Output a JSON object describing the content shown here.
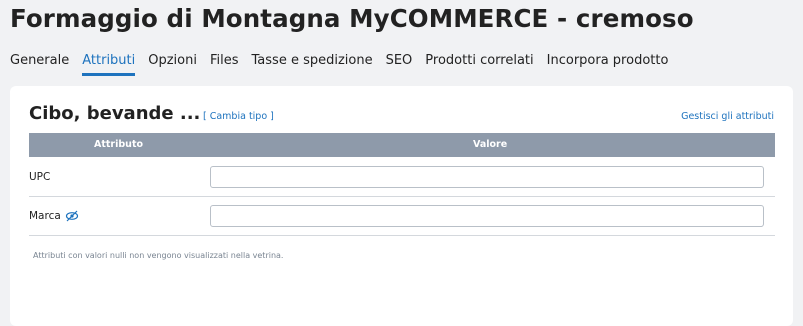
{
  "page": {
    "title": "Formaggio di Montagna MyCOMMERCE - cremoso"
  },
  "tabs": [
    {
      "label": "Generale"
    },
    {
      "label": "Attributi"
    },
    {
      "label": "Opzioni"
    },
    {
      "label": "Files"
    },
    {
      "label": "Tasse e spedizione"
    },
    {
      "label": "SEO"
    },
    {
      "label": "Prodotti correlati"
    },
    {
      "label": "Incorpora prodotto"
    }
  ],
  "active_tab": "Attributi",
  "card": {
    "title": "Cibo, bevande ...",
    "change_type_label": "[ Cambia tipo ]",
    "manage_label": "Gestisci gli attributi",
    "table": {
      "headers": {
        "attribute": "Attributo",
        "value": "Valore"
      },
      "rows": [
        {
          "label": "UPC",
          "value": "",
          "icon": null
        },
        {
          "label": "Marca",
          "value": "",
          "icon": "eye-slash-icon"
        }
      ]
    },
    "footnote": "Attributi con valori nulli non vengono visualizzati nella vetrina."
  },
  "colors": {
    "accent": "#1e73be",
    "table_header_bg": "#8e9aaa",
    "page_bg": "#f1f2f4"
  }
}
